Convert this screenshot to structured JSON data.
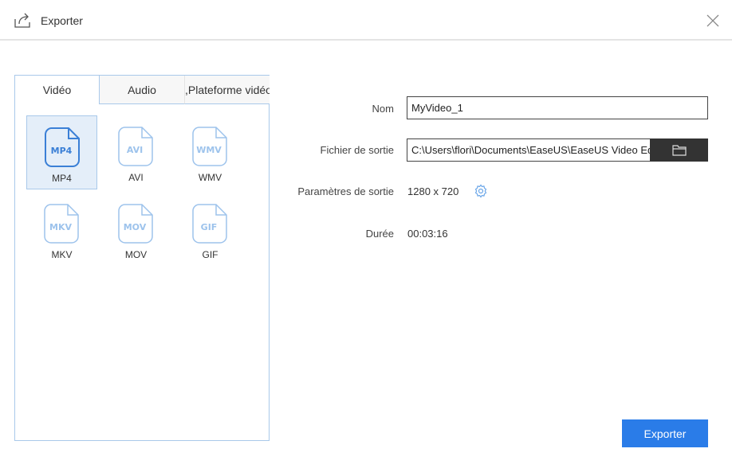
{
  "header": {
    "title": "Exporter"
  },
  "tabs": [
    {
      "label": "Vidéo"
    },
    {
      "label": "Audio"
    },
    {
      "label": ",Plateforme vidéo"
    }
  ],
  "formats": [
    {
      "icon_text": "MP4",
      "label": "MP4",
      "selected": true
    },
    {
      "icon_text": "AVI",
      "label": "AVI"
    },
    {
      "icon_text": "WMV",
      "label": "WMV"
    },
    {
      "icon_text": "MKV",
      "label": "MKV"
    },
    {
      "icon_text": "MOV",
      "label": "MOV"
    },
    {
      "icon_text": "GIF",
      "label": "GIF"
    }
  ],
  "form": {
    "name_label": "Nom",
    "name_value": "MyVideo_1",
    "output_label": "Fichier de sortie",
    "output_value": "C:\\Users\\flori\\Documents\\EaseUS\\EaseUS Video Editor",
    "params_label": "Paramètres de sortie",
    "params_value": "1280 x 720",
    "duration_label": "Durée",
    "duration_value": "00:03:16"
  },
  "export_label": "Exporter",
  "colors": {
    "accent": "#2a7ce8",
    "selected_icon": "#3a7fd6",
    "icon": "#9dc3ec"
  }
}
